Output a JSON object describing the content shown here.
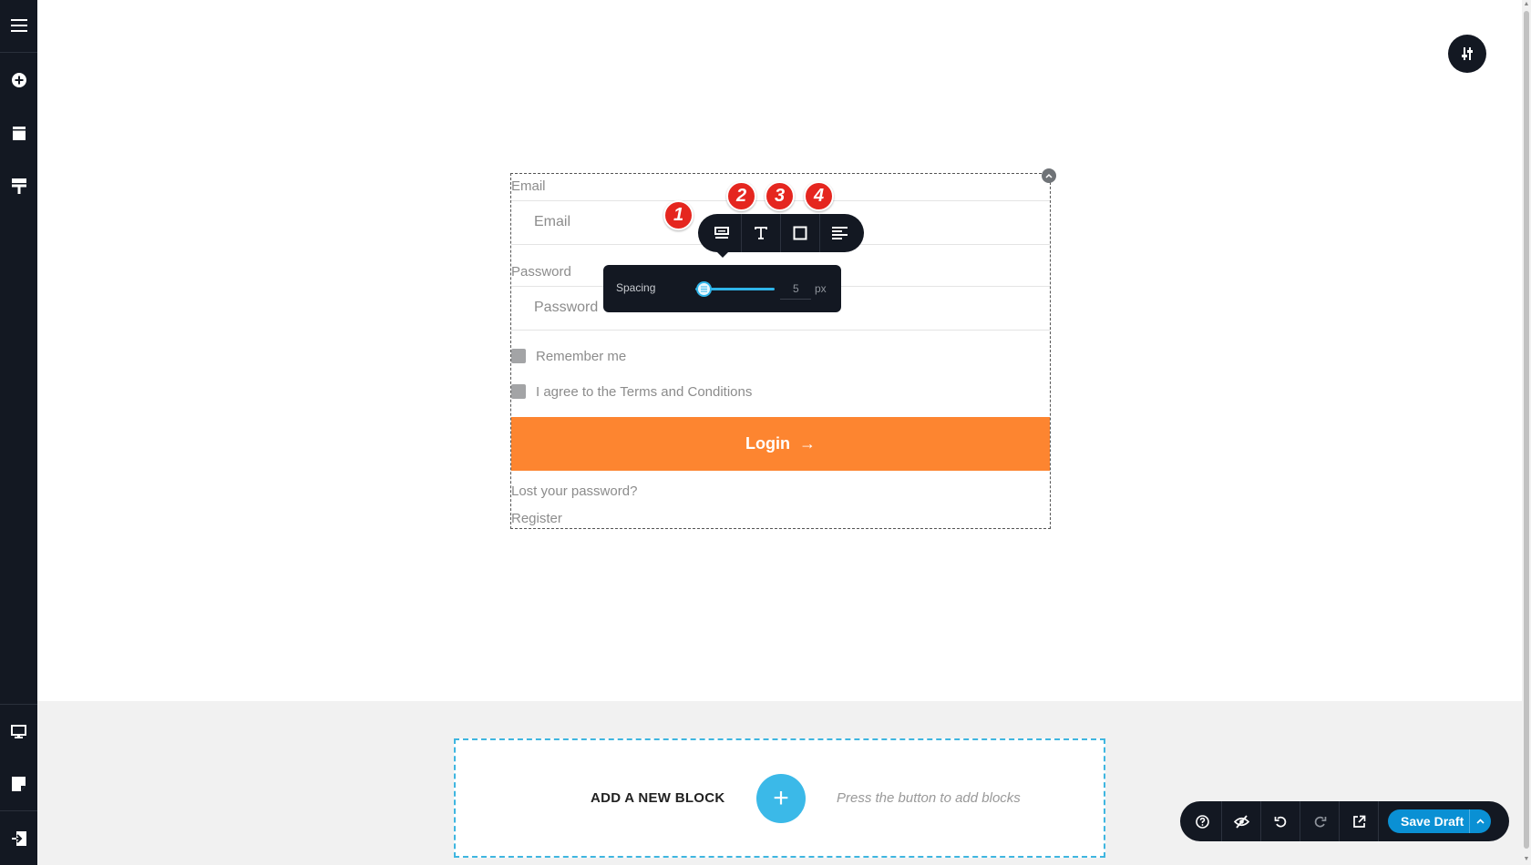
{
  "form": {
    "email_label": "Email",
    "email_placeholder": "Email",
    "password_label": "Password",
    "password_placeholder": "Password",
    "remember_label": "Remember me",
    "terms_label": "I agree to the Terms and Conditions",
    "login_label": "Login",
    "login_arrow": "→",
    "lost_password": "Lost your password?",
    "register": "Register"
  },
  "toolbar": {
    "buttons": [
      {
        "icon": "spacing-icon",
        "badge": "1"
      },
      {
        "icon": "typography-icon",
        "badge": "2"
      },
      {
        "icon": "border-icon",
        "badge": "3"
      },
      {
        "icon": "align-icon",
        "badge": "4"
      }
    ]
  },
  "spacing_popover": {
    "label": "Spacing",
    "value": "5",
    "unit": "px",
    "slider_fraction": 0.05
  },
  "add_block": {
    "title": "ADD A NEW BLOCK",
    "plus": "+",
    "hint": "Press the button to add blocks"
  },
  "action_bar": {
    "save_label": "Save Draft",
    "icons": [
      "help-icon",
      "hide-icon",
      "undo-icon",
      "redo-icon",
      "preview-icon",
      "chevron-up-icon"
    ]
  },
  "sidebar": {
    "icons": [
      "menu-icon",
      "add-circle-icon",
      "layout-icon",
      "paint-roller-icon",
      "desktop-icon",
      "page-icon",
      "exit-icon"
    ]
  },
  "colors": {
    "sidebar_bg": "#131822",
    "login_button": "#fd8530",
    "accent_blue": "#3bb9e8",
    "badge_red": "#e5261f",
    "save_button": "#0a90d4"
  }
}
